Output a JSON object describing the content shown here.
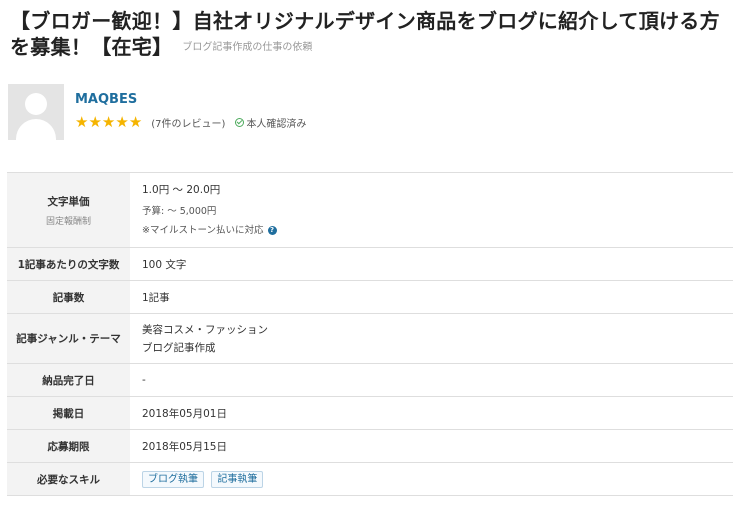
{
  "job": {
    "title": "【ブロガー歓迎！】自社オリジナルデザイン商品をブログに紹介して頂ける方を募集！【在宅】",
    "category": "ブログ記事作成の仕事の依頼"
  },
  "client": {
    "name": "MAQBES",
    "rating_stars": 5,
    "reviews": "(7件のレビュー)",
    "verified": "本人確認済み"
  },
  "details": {
    "price": {
      "label": "文字単価",
      "sublabel": "固定報酬制",
      "value": "1.0円 〜 20.0円",
      "budget": "予算: 〜 5,000円",
      "milestone": "※マイルストーン払いに対応"
    },
    "chars_per_article": {
      "label": "1記事あたりの文字数",
      "value": "100 文字"
    },
    "article_count": {
      "label": "記事数",
      "value": "1記事"
    },
    "genre": {
      "label": "記事ジャンル・テーマ",
      "values": [
        "美容コスメ・ファッション",
        "ブログ記事作成"
      ]
    },
    "delivery_date": {
      "label": "納品完了日",
      "value": "-"
    },
    "posted_date": {
      "label": "掲載日",
      "value": "2018年05月01日"
    },
    "deadline": {
      "label": "応募期限",
      "value": "2018年05月15日"
    },
    "skills": {
      "label": "必要なスキル",
      "values": [
        "ブログ執筆",
        "記事執筆"
      ]
    }
  },
  "colors": {
    "accent": "#1f6e9e",
    "star": "#f5b400",
    "verified": "#4caa5c",
    "label_bg": "#f3f3f3"
  }
}
